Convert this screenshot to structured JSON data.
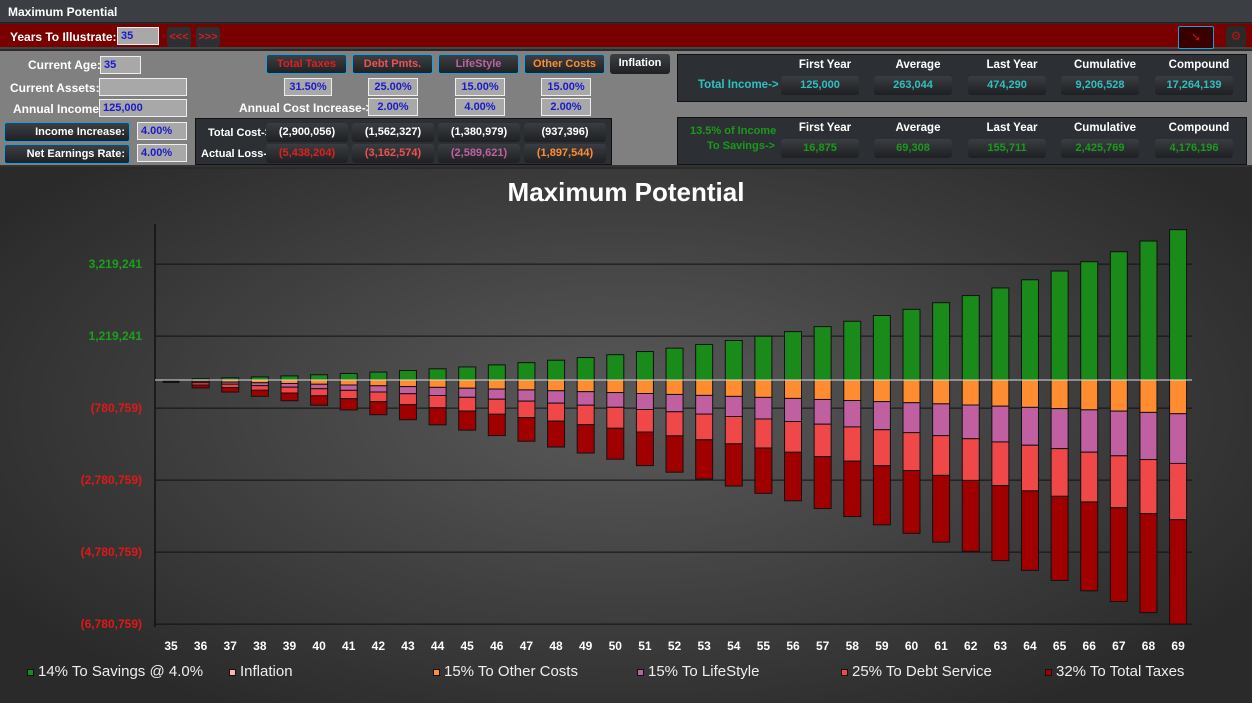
{
  "window": {
    "title": "Maximum Potential"
  },
  "toolbar": {
    "years_label": "Years To Illustrate:",
    "years_value": "35",
    "prev_label": "<<<",
    "next_label": ">>>"
  },
  "inputs": {
    "current_age_label": "Current Age:",
    "current_age": "35",
    "current_assets_label": "Current Assets:",
    "current_assets": "",
    "annual_income_label": "Annual Income:",
    "annual_income": "125,000",
    "income_increase_label": "Income Increase:",
    "income_increase": "4.00%",
    "net_earnings_label": "Net Earnings Rate:",
    "net_earnings": "4.00%"
  },
  "costs": {
    "annual_cost_increase_label": "Annual Cost Increase->",
    "total_cost_label": "Total Cost->",
    "actual_loss_label": "Actual Loss->",
    "inflation_label": "Inflation",
    "categories": [
      {
        "label": "Total Taxes",
        "color": "#e02020",
        "rate": "31.50%",
        "increase": "",
        "total_cost": "(2,900,056)",
        "actual_loss": "(5,438,204)"
      },
      {
        "label": "Debt Pmts.",
        "color": "#f05050",
        "rate": "25.00%",
        "increase": "2.00%",
        "total_cost": "(1,562,327)",
        "actual_loss": "(3,162,574)"
      },
      {
        "label": "LifeStyle",
        "color": "#c060a0",
        "rate": "15.00%",
        "increase": "4.00%",
        "total_cost": "(1,380,979)",
        "actual_loss": "(2,589,621)"
      },
      {
        "label": "Other Costs",
        "color": "#ff8c30",
        "rate": "15.00%",
        "increase": "2.00%",
        "total_cost": "(937,396)",
        "actual_loss": "(1,897,544)"
      }
    ]
  },
  "summary": {
    "headers": [
      "First Year",
      "Average",
      "Last Year",
      "Cumulative",
      "Compound"
    ],
    "income_label": "Total Income->",
    "income_values": [
      "125,000",
      "263,044",
      "474,290",
      "9,206,528",
      "17,264,139"
    ],
    "savings_label_1": "13.5% of Income",
    "savings_label_2": "To Savings->",
    "savings_values": [
      "16,875",
      "69,308",
      "155,711",
      "2,425,769",
      "4,176,196"
    ]
  },
  "chart_data": {
    "type": "bar",
    "title": "Maximum Potential",
    "stacked": true,
    "categories": [
      "35",
      "36",
      "37",
      "38",
      "39",
      "40",
      "41",
      "42",
      "43",
      "44",
      "45",
      "46",
      "47",
      "48",
      "49",
      "50",
      "51",
      "52",
      "53",
      "54",
      "55",
      "56",
      "57",
      "58",
      "59",
      "60",
      "61",
      "62",
      "63",
      "64",
      "65",
      "66",
      "67",
      "68",
      "69"
    ],
    "yticks": [
      "3,219,241",
      "1,219,241",
      "(780,759)",
      "(2,780,759)",
      "(4,780,759)",
      "(6,780,759)"
    ],
    "ytick_values": [
      3219241,
      1219241,
      -780759,
      -2780759,
      -4780759,
      -6780759
    ],
    "ylim": [
      -6780759,
      4176196
    ],
    "grid": true,
    "legend_position": "bottom",
    "series": [
      {
        "name": "14% To Savings @ 4.0%",
        "color": "#1a8a1a",
        "values": [
          0,
          37544,
          60164,
          85634,
          114140,
          145922,
          181199,
          220241,
          263318,
          310700,
          362690,
          419609,
          481801,
          549609,
          623428,
          703643,
          790670,
          884967,
          987002,
          1097252,
          1216259,
          1344585,
          1482801,
          1631531,
          1791431,
          1963187,
          2147527,
          2345210,
          2557048,
          2783893,
          3026629,
          3286223,
          3563654,
          3859991,
          4176196
        ]
      },
      {
        "name": "Inflation",
        "color": "#ffb0b0",
        "values": [
          0,
          0,
          0,
          0,
          0,
          0,
          0,
          0,
          0,
          0,
          0,
          0,
          0,
          0,
          0,
          0,
          0,
          0,
          0,
          0,
          0,
          0,
          0,
          0,
          0,
          0,
          0,
          0,
          0,
          0,
          0,
          0,
          0,
          0,
          0
        ]
      },
      {
        "name": "15% To Other Costs",
        "color": "#ff8c30",
        "values": [
          0,
          -37900,
          -57400,
          -77300,
          -97600,
          -118300,
          -139400,
          -160900,
          -182900,
          -205300,
          -228200,
          -251500,
          -275300,
          -299500,
          -324300,
          -349500,
          -375200,
          -401500,
          -428300,
          -455600,
          -483400,
          -511900,
          -540800,
          -570400,
          -600600,
          -631300,
          -662700,
          -694700,
          -727400,
          -760700,
          -794600,
          -829300,
          -864600,
          -900600,
          -937396
        ]
      },
      {
        "name": "15% To LifeStyle",
        "color": "#c060a0",
        "values": [
          0,
          -38300,
          -58500,
          -79600,
          -101600,
          -124400,
          -148100,
          -172800,
          -198400,
          -225100,
          -252900,
          -281700,
          -311800,
          -343000,
          -375400,
          -409200,
          -444300,
          -480900,
          -518800,
          -558300,
          -599400,
          -642200,
          -686600,
          -732800,
          -780900,
          -830800,
          -882800,
          -936900,
          -993100,
          -1051600,
          -1112400,
          -1175700,
          -1241400,
          -1309800,
          -1380979
        ]
      },
      {
        "name": "25% To Debt Service",
        "color": "#f04848",
        "values": [
          0,
          -63100,
          -95600,
          -128800,
          -162600,
          -197100,
          -232300,
          -268200,
          -304800,
          -342200,
          -380300,
          -419100,
          -458800,
          -499200,
          -540400,
          -582500,
          -625400,
          -669100,
          -713800,
          -759300,
          -805700,
          -853100,
          -901400,
          -950700,
          -1000900,
          -1052200,
          -1104500,
          -1157900,
          -1212300,
          -1267800,
          -1324400,
          -1382100,
          -1441000,
          -1501100,
          -1562327
        ]
      },
      {
        "name": "32% To Total Taxes",
        "color": "#a00000",
        "values": [
          0,
          -80300,
          -122900,
          -167200,
          -213300,
          -261200,
          -311000,
          -362800,
          -416700,
          -472700,
          -531000,
          -591600,
          -654700,
          -720200,
          -788400,
          -859300,
          -933100,
          -1009800,
          -1089600,
          -1172500,
          -1258800,
          -1348500,
          -1441800,
          -1538900,
          -1639800,
          -1744800,
          -1854000,
          -1967500,
          -2085500,
          -2208300,
          -2336000,
          -2468900,
          -2607000,
          -2750700,
          -2900056
        ]
      }
    ]
  }
}
